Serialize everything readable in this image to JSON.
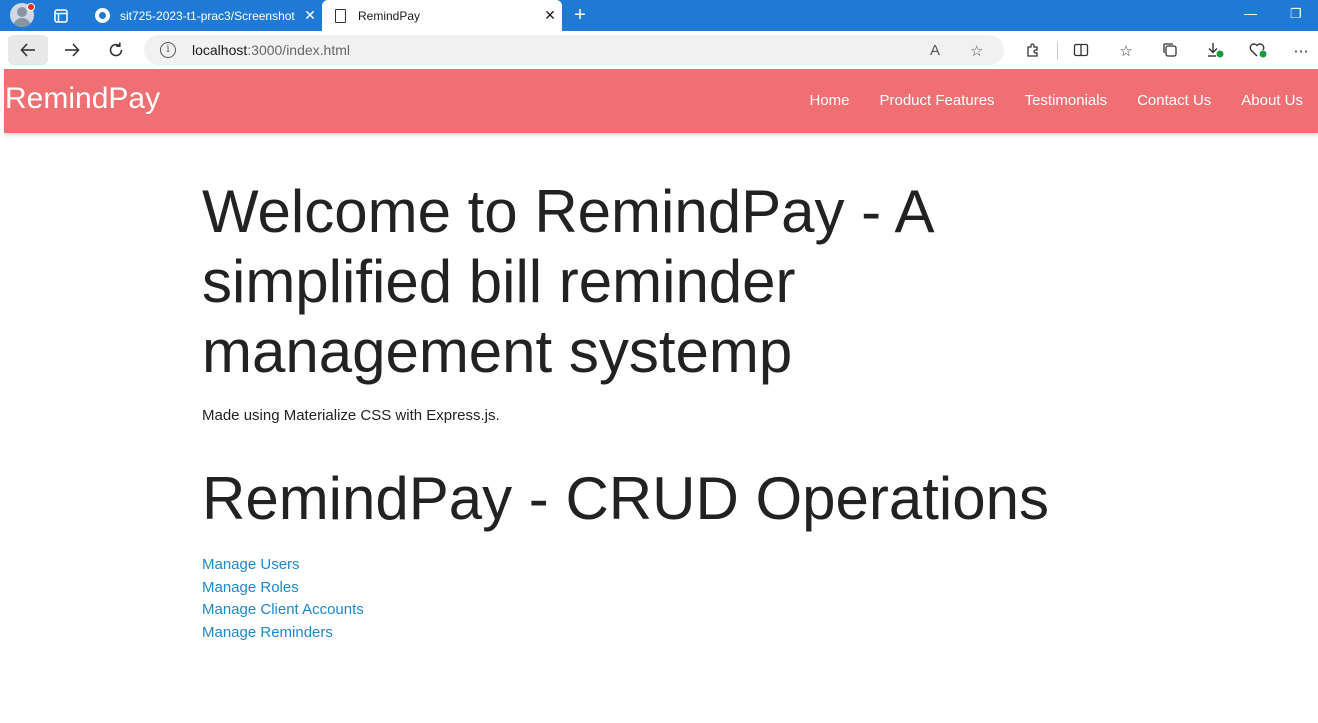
{
  "browser": {
    "tabs": [
      {
        "label": "sit725-2023-t1-prac3/Screenshot",
        "close": "✕"
      },
      {
        "label": "RemindPay",
        "close": "✕"
      }
    ],
    "new_tab": "+",
    "window_controls": {
      "minimize": "—",
      "restore": "❐"
    },
    "url_host": "localhost",
    "url_path": ":3000/index.html"
  },
  "navbar": {
    "brand": "RemindPay",
    "links": [
      "Home",
      "Product Features",
      "Testimonials",
      "Contact Us",
      "About Us"
    ],
    "background": "#ef6f72"
  },
  "main": {
    "hero_title": "Welcome to RemindPay - A simplified bill reminder management systemp",
    "subtitle": "Made using Materialize CSS with Express.js.",
    "section_title": "RemindPay - CRUD Operations",
    "links": [
      "Manage Users",
      "Manage Roles",
      "Manage Client Accounts",
      "Manage Reminders"
    ],
    "link_color": "#1e88c8"
  }
}
